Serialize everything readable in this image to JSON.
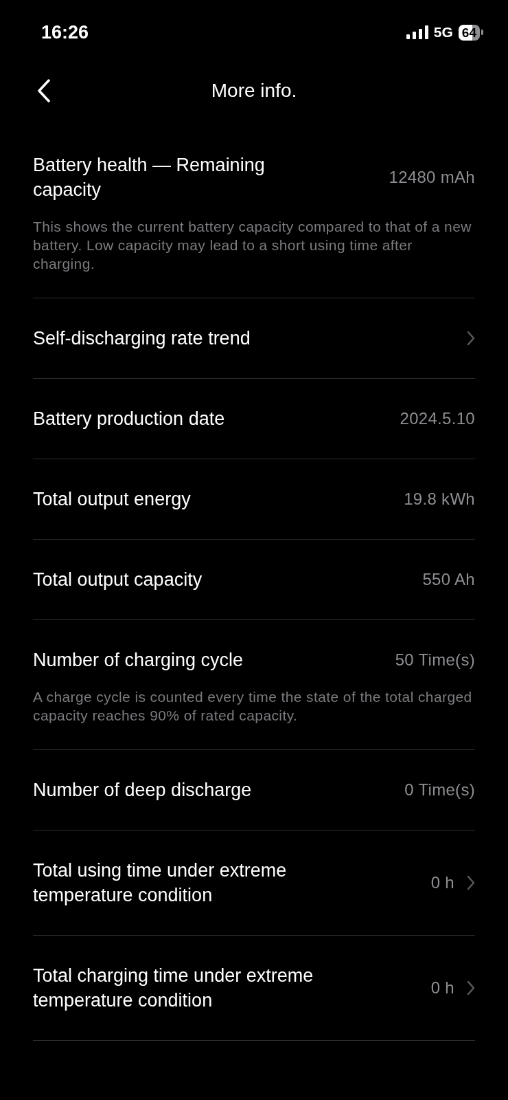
{
  "status_bar": {
    "time": "16:26",
    "network": "5G",
    "battery": "64"
  },
  "header": {
    "title": "More info."
  },
  "rows": [
    {
      "label": "Battery health — Remaining capacity",
      "value": "12480 mAh",
      "chevron": false,
      "description": "This shows the current battery capacity compared to that of a new battery. Low capacity may lead to a short using time after charging."
    },
    {
      "label": "Self-discharging rate trend",
      "chevron": true
    },
    {
      "label": "Battery production date",
      "value": "2024.5.10",
      "chevron": false
    },
    {
      "label": "Total output energy",
      "value": "19.8 kWh",
      "chevron": false
    },
    {
      "label": "Total output capacity",
      "value": "550 Ah",
      "chevron": false
    },
    {
      "label": "Number of charging cycle",
      "value": "50 Time(s)",
      "chevron": false,
      "description": "A charge cycle is counted every time the state of the total charged capacity reaches 90% of rated capacity."
    },
    {
      "label": "Number of deep discharge",
      "value": "0 Time(s)",
      "chevron": false
    },
    {
      "label": "Total using time under extreme temperature condition",
      "value": "0 h",
      "chevron": true
    },
    {
      "label": "Total charging time under extreme temperature condition",
      "value": "0 h",
      "chevron": true
    }
  ]
}
